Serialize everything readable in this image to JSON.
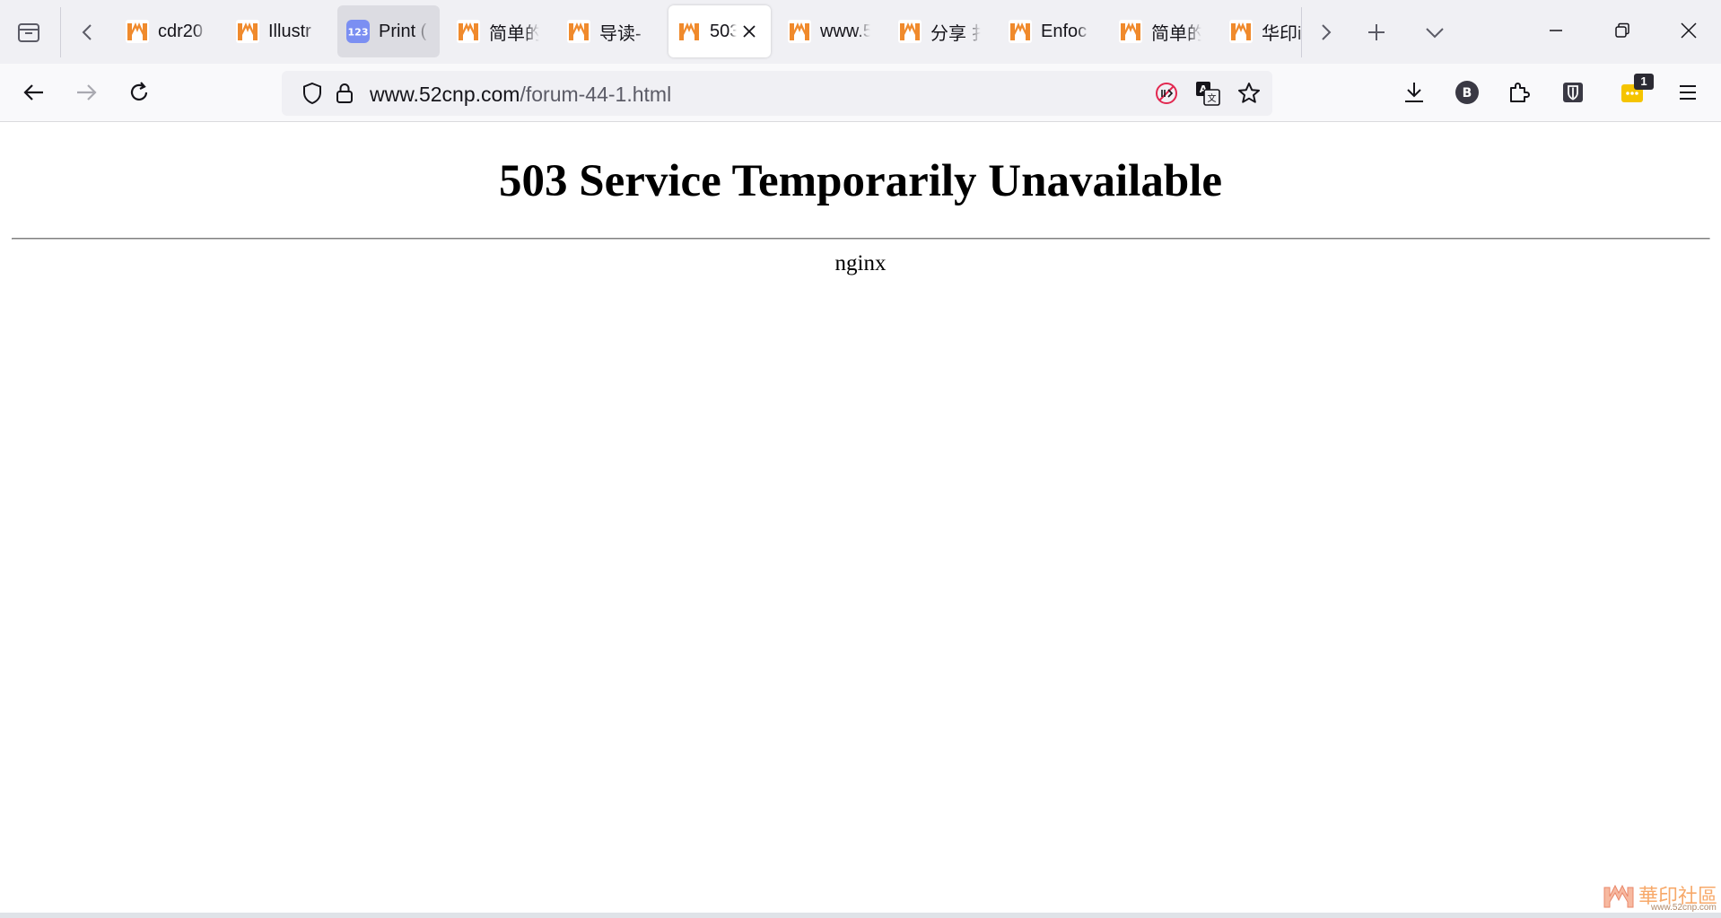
{
  "browser": {
    "tabs": [
      {
        "title": "cdr20",
        "favicon": "forum-logo-icon"
      },
      {
        "title": "Illustr",
        "favicon": "forum-logo-icon"
      },
      {
        "title": "Print (",
        "favicon": "123-icon",
        "highlighted": true
      },
      {
        "title": "简单的",
        "favicon": "forum-logo-icon"
      },
      {
        "title": "导读-",
        "favicon": "forum-logo-icon"
      },
      {
        "title": "503",
        "favicon": "forum-logo-icon",
        "active": true
      },
      {
        "title": "www.5",
        "favicon": "forum-logo-icon"
      },
      {
        "title": "分享 扌",
        "favicon": "forum-logo-icon"
      },
      {
        "title": "Enfoc",
        "favicon": "forum-logo-icon"
      },
      {
        "title": "简单的",
        "favicon": "forum-logo-icon"
      },
      {
        "title": "华印i",
        "favicon": "forum-logo-icon"
      }
    ],
    "favicon_123_label": "123",
    "url": {
      "domain": "www.52cnp.com",
      "path": "/forum-44-1.html"
    },
    "extension_badge": "1",
    "profile_letter": "B"
  },
  "page": {
    "heading": "503 Service Temporarily Unavailable",
    "server": "nginx"
  },
  "watermark": {
    "text": "華印社區",
    "sub": "www.52cnp.com"
  },
  "colors": {
    "tab_strip": "#f0f0f4",
    "toolbar": "#f9f9fb",
    "favicon_orange": "#f08a2c",
    "favicon_blue": "#7b8ff2",
    "extension_yellow": "#f5c400"
  }
}
